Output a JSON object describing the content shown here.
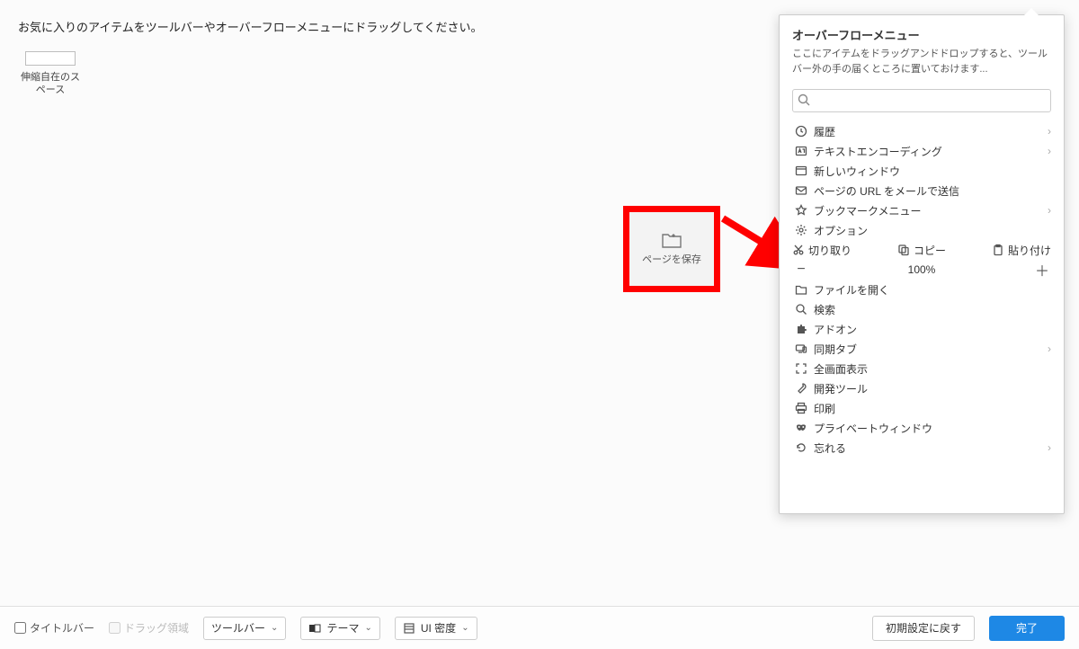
{
  "instruction": "お気に入りのアイテムをツールバーやオーバーフローメニューにドラッグしてください。",
  "flex_space_label": "伸縮自在のスペース",
  "dragged_item_label": "ページを保存",
  "overflow": {
    "title": "オーバーフローメニュー",
    "description": "ここにアイテムをドラッグアンドドロップすると、ツールバー外の手の届くところに置いておけます...",
    "search_placeholder": ""
  },
  "menu": {
    "history": "履歴",
    "encoding": "テキストエンコーディング",
    "new_window": "新しいウィンドウ",
    "email_link": "ページの URL をメールで送信",
    "bookmarks": "ブックマークメニュー",
    "options": "オプション",
    "cut": "切り取り",
    "copy": "コピー",
    "paste": "貼り付け",
    "zoom_value": "100%",
    "open_file": "ファイルを開く",
    "find": "検索",
    "addons": "アドオン",
    "synced_tabs": "同期タブ",
    "fullscreen": "全画面表示",
    "devtools": "開発ツール",
    "print": "印刷",
    "private_window": "プライベートウィンドウ",
    "forget": "忘れる"
  },
  "bottom": {
    "titlebar": "タイトルバー",
    "drag_area": "ドラッグ領域",
    "toolbars_dd": "ツールバー",
    "theme_dd": "テーマ",
    "density_dd": "UI 密度",
    "reset": "初期設定に戻す",
    "done": "完了"
  }
}
